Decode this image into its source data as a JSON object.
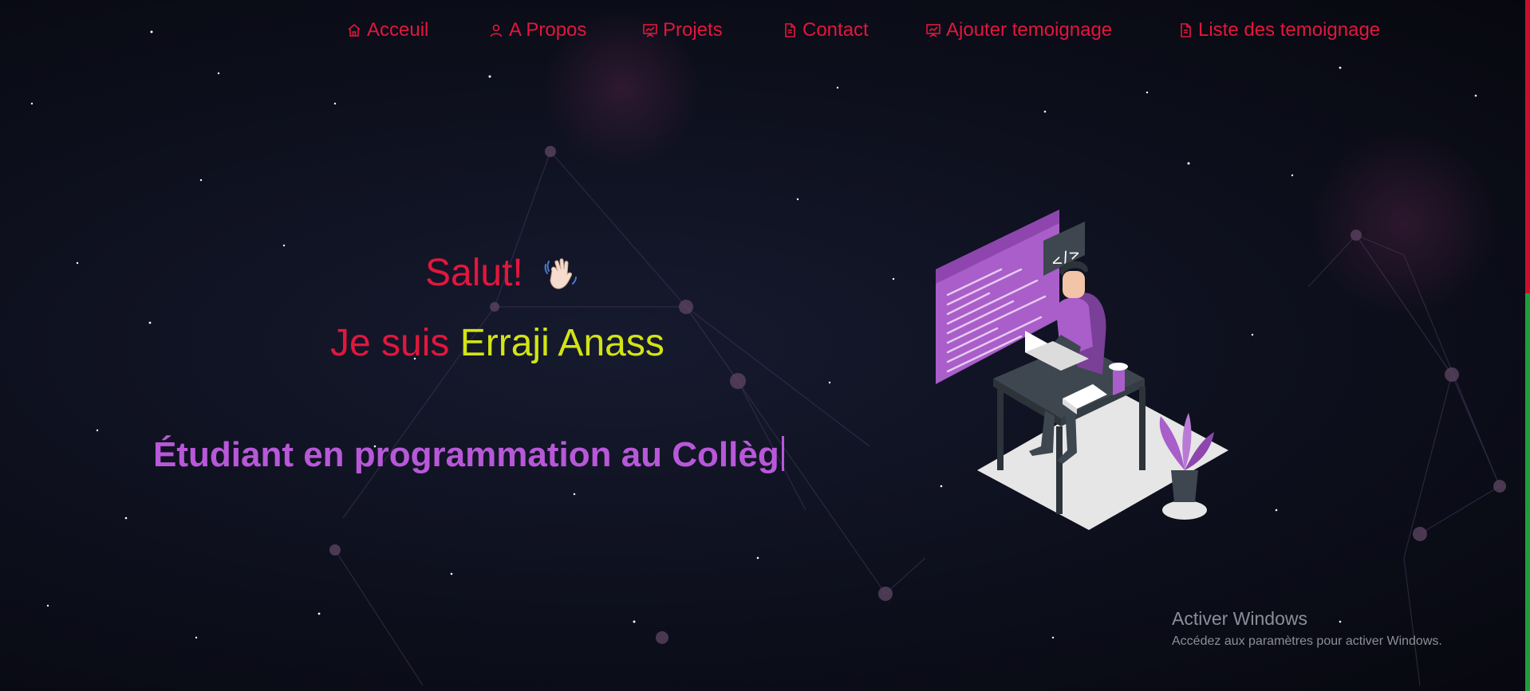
{
  "nav": {
    "items": [
      {
        "label": "Acceuil",
        "icon": "home-icon"
      },
      {
        "label": "A Propos",
        "icon": "user-icon"
      },
      {
        "label": "Projets",
        "icon": "presentation-icon"
      },
      {
        "label": "Contact",
        "icon": "document-icon"
      },
      {
        "label": "Ajouter temoignage",
        "icon": "presentation-icon"
      },
      {
        "label": "Liste des temoignage",
        "icon": "document-icon"
      }
    ]
  },
  "hero": {
    "greeting": "Salut!",
    "intro_prefix": "Je suis ",
    "name": "Erraji Anass",
    "role_typed": "Étudiant en programmation au Collèg"
  },
  "illustration": {
    "code_tag": "</>"
  },
  "windows": {
    "title": "Activer Windows",
    "subtitle": "Accédez aux paramètres pour activer Windows."
  },
  "colors": {
    "accent_red": "#e3163d",
    "name_yellow": "#d3e414",
    "role_purple": "#b858d9",
    "illustration_purple": "#a95ec9",
    "desk_dark": "#3e474f"
  }
}
